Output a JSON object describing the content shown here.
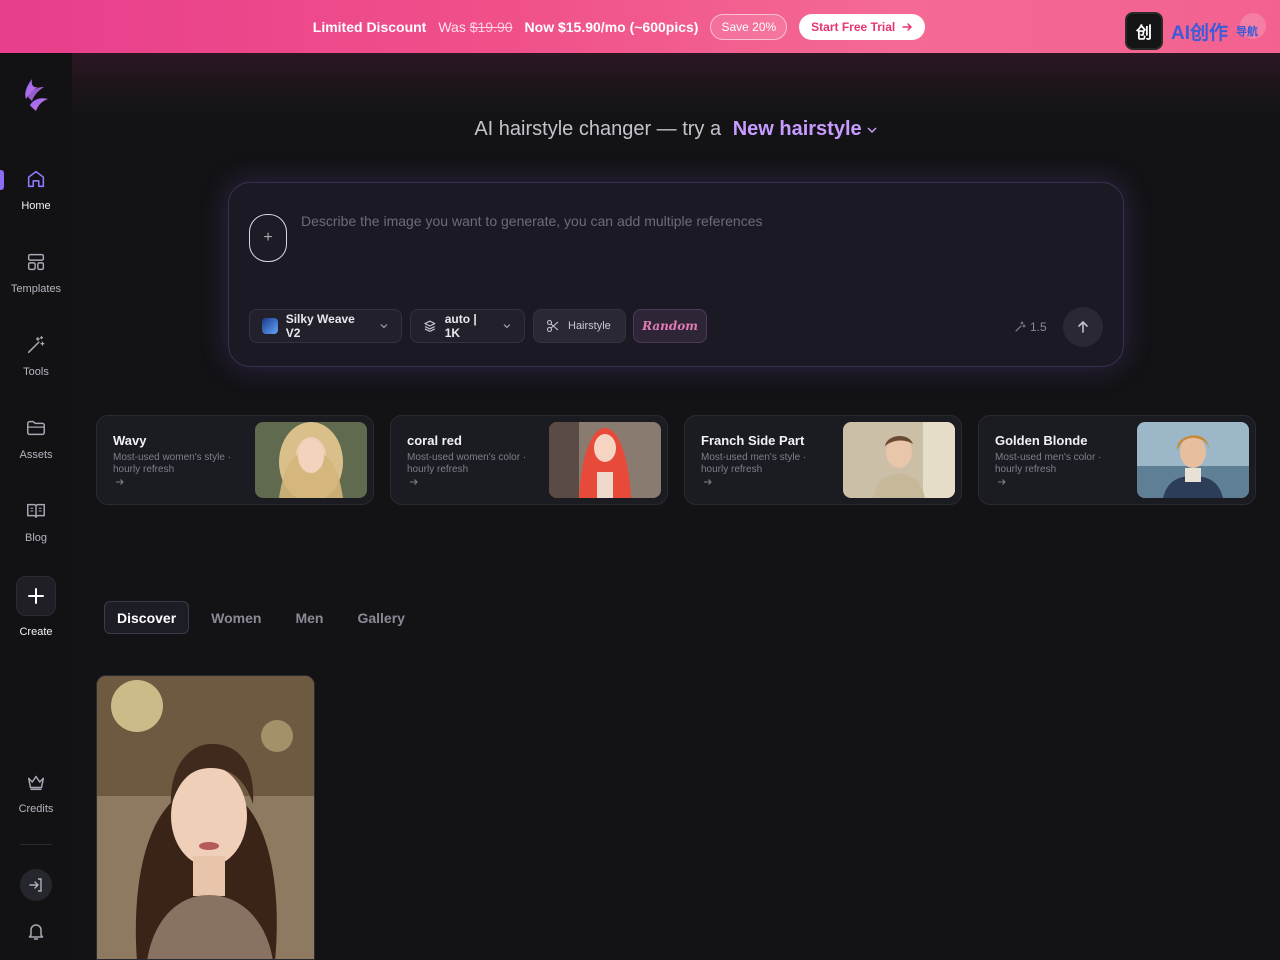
{
  "banner": {
    "title": "Limited Discount",
    "was_label": "Was",
    "was_price": "$19.90",
    "now_text": "Now $15.90/mo (~600pics)",
    "save_badge": "Save 20%",
    "trial_button": "Start Free Trial"
  },
  "brand": {
    "icon_text": "创",
    "name": "AI创作",
    "sub": "导航"
  },
  "sidebar": {
    "items": [
      {
        "label": "Home",
        "icon": "home-icon"
      },
      {
        "label": "Templates",
        "icon": "templates-icon"
      },
      {
        "label": "Tools",
        "icon": "magic-wand-icon"
      },
      {
        "label": "Assets",
        "icon": "folder-icon"
      },
      {
        "label": "Blog",
        "icon": "book-icon"
      },
      {
        "label": "Create",
        "icon": "plus-icon"
      },
      {
        "label": "Credits",
        "icon": "crown-icon"
      }
    ]
  },
  "headline": {
    "prefix": "AI hairstyle changer — try a",
    "accent": "New hairstyle"
  },
  "prompt": {
    "placeholder": "Describe the image you want to generate, you can add multiple references",
    "add_symbol": "+",
    "model": "Silky Weave V2",
    "ratio": "auto | 1K",
    "mode": "Hairstyle",
    "random": "Random",
    "cost": "1.5"
  },
  "cards": [
    {
      "title": "Wavy",
      "subtitle": "Most-used women's style · hourly refresh"
    },
    {
      "title": "coral red",
      "subtitle": "Most-used women's color · hourly refresh"
    },
    {
      "title": "Franch Side Part",
      "subtitle": "Most-used men's style · hourly refresh"
    },
    {
      "title": "Golden Blonde",
      "subtitle": "Most-used men's color · hourly refresh"
    }
  ],
  "tabs": [
    "Discover",
    "Women",
    "Men",
    "Gallery"
  ],
  "colors": {
    "accent": "#c89cff",
    "banner_pink": "#f0508a",
    "background": "#131316"
  }
}
